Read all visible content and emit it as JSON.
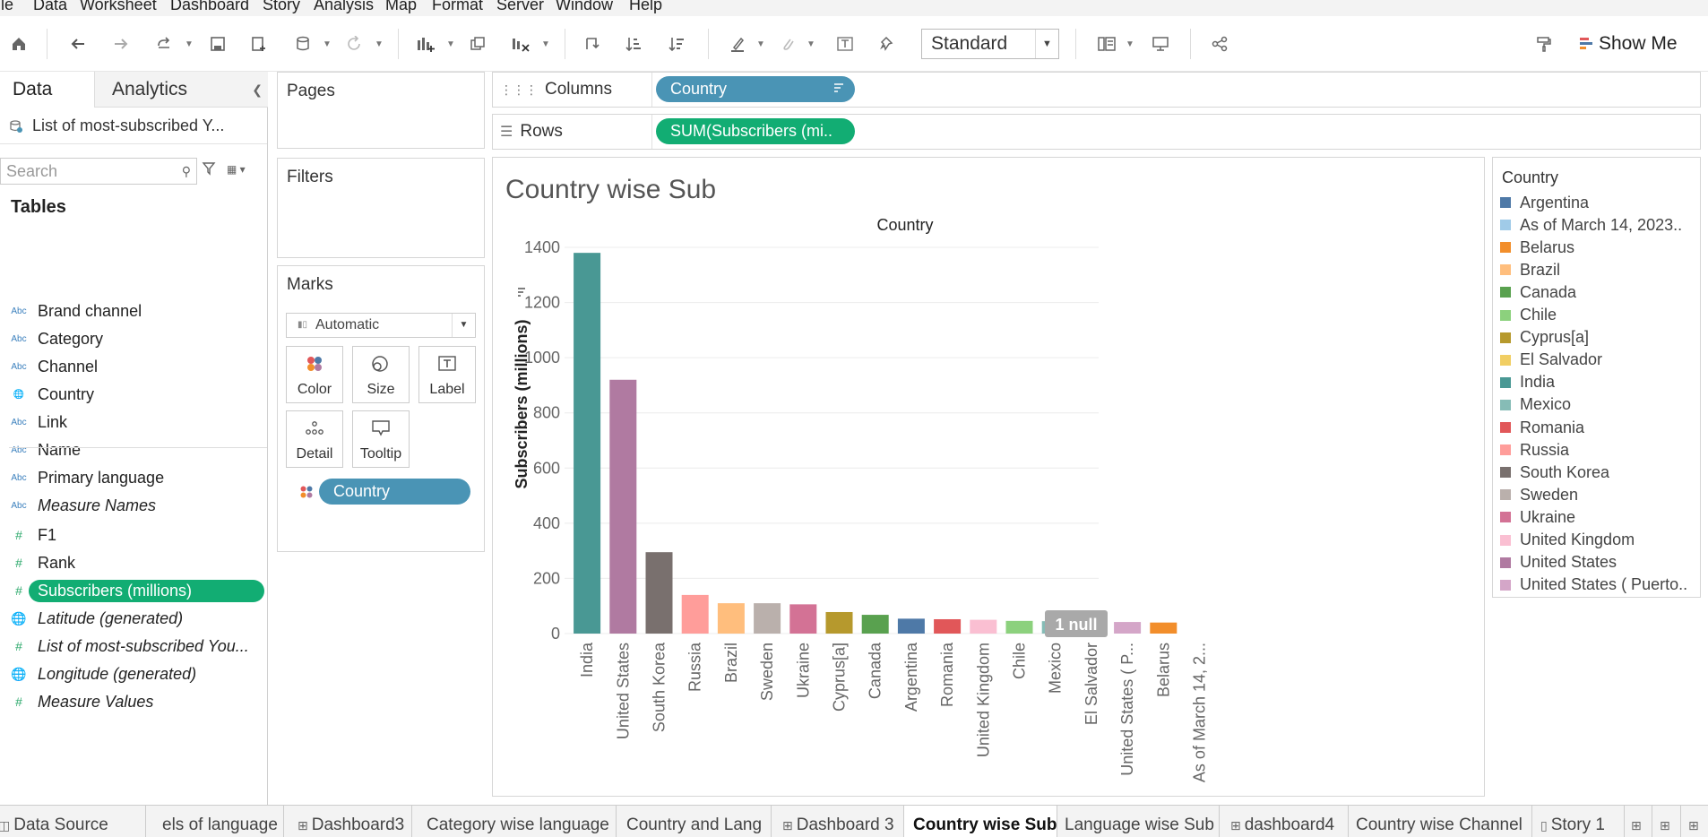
{
  "menu": [
    "File",
    "Data",
    "Worksheet",
    "Dashboard",
    "Story",
    "Analysis",
    "Map",
    "Format",
    "Server",
    "Window",
    "Help"
  ],
  "toolbar": {
    "view_size": "Standard",
    "show_me": "Show Me"
  },
  "data_pane": {
    "tabs": [
      "Data",
      "Analytics"
    ],
    "datasource": "List of most-subscribed Y...",
    "search_placeholder": "Search",
    "tables_header": "Tables",
    "dimensions": [
      {
        "type": "Abc",
        "name": "Brand channel"
      },
      {
        "type": "Abc",
        "name": "Category"
      },
      {
        "type": "Abc",
        "name": "Channel"
      },
      {
        "type": "geo",
        "name": "Country"
      },
      {
        "type": "Abc",
        "name": "Link"
      },
      {
        "type": "Abc",
        "name": "Name"
      },
      {
        "type": "Abc",
        "name": "Primary language"
      },
      {
        "type": "Abc",
        "name": "Measure Names"
      }
    ],
    "measures": [
      {
        "type": "#",
        "name": "F1"
      },
      {
        "type": "#",
        "name": "Rank"
      },
      {
        "type": "#",
        "name": "Subscribers (millions)"
      },
      {
        "type": "geo",
        "name": "Latitude (generated)"
      },
      {
        "type": "#",
        "name": "List of most-subscribed You..."
      },
      {
        "type": "geo",
        "name": "Longitude (generated)"
      },
      {
        "type": "#",
        "name": "Measure Values"
      }
    ]
  },
  "cards": {
    "pages": "Pages",
    "filters": "Filters",
    "marks": "Marks",
    "mark_type": "Automatic",
    "mark_buttons": [
      "Color",
      "Size",
      "Label",
      "Detail",
      "Tooltip"
    ],
    "marks_pill": "Country"
  },
  "shelves": {
    "columns_label": "Columns",
    "columns_pill": "Country",
    "rows_label": "Rows",
    "rows_pill": "SUM(Subscribers (mi.."
  },
  "view": {
    "sheet_title": "Country wise Sub",
    "null_badge": "1 null"
  },
  "legend": {
    "title": "Country",
    "items": [
      {
        "label": "Argentina",
        "color": "#4e79a7"
      },
      {
        "label": "As of March 14, 2023..",
        "color": "#a0cbe8"
      },
      {
        "label": "Belarus",
        "color": "#f28e2b"
      },
      {
        "label": "Brazil",
        "color": "#ffbe7d"
      },
      {
        "label": "Canada",
        "color": "#59a14f"
      },
      {
        "label": "Chile",
        "color": "#8cd17d"
      },
      {
        "label": "Cyprus[a]",
        "color": "#b6992d"
      },
      {
        "label": "El Salvador",
        "color": "#f1ce63"
      },
      {
        "label": "India",
        "color": "#499894"
      },
      {
        "label": "Mexico",
        "color": "#86bcb6"
      },
      {
        "label": "Romania",
        "color": "#e15759"
      },
      {
        "label": "Russia",
        "color": "#ff9d9a"
      },
      {
        "label": "South Korea",
        "color": "#79706e"
      },
      {
        "label": "Sweden",
        "color": "#bab0ac"
      },
      {
        "label": "Ukraine",
        "color": "#d37295"
      },
      {
        "label": "United Kingdom",
        "color": "#fabfd2"
      },
      {
        "label": "United States",
        "color": "#b07aa1"
      },
      {
        "label": "United States ( Puerto..",
        "color": "#d4a6c8"
      }
    ]
  },
  "chart_data": {
    "type": "bar",
    "title": "Country",
    "xlabel": "Country",
    "ylabel": "Subscribers (millions)",
    "ylim": [
      0,
      1400
    ],
    "yticks": [
      0,
      200,
      400,
      600,
      800,
      1000,
      1200,
      1400
    ],
    "categories": [
      "India",
      "United States",
      "South Korea",
      "Russia",
      "Brazil",
      "Sweden",
      "Ukraine",
      "Cyprus[a]",
      "Canada",
      "Argentina",
      "Romania",
      "United Kingdom",
      "Chile",
      "Mexico",
      "El Salvador",
      "United States ( P...",
      "Belarus",
      "As of March 14, 2..."
    ],
    "values": [
      1380,
      920,
      295,
      140,
      110,
      110,
      106,
      78,
      68,
      54,
      52,
      50,
      46,
      45,
      43,
      42,
      40,
      0
    ],
    "colors": [
      "#499894",
      "#b07aa1",
      "#79706e",
      "#ff9d9a",
      "#ffbe7d",
      "#bab0ac",
      "#d37295",
      "#b6992d",
      "#59a14f",
      "#4e79a7",
      "#e15759",
      "#fabfd2",
      "#8cd17d",
      "#86bcb6",
      "#f1ce63",
      "#d4a6c8",
      "#f28e2b",
      "#a0cbe8"
    ],
    "grid": true,
    "legend": "right"
  },
  "tabs": [
    {
      "label": "Data Source",
      "icon": "data-source-icon",
      "active": false
    },
    {
      "label": "els of language",
      "icon": "",
      "active": false
    },
    {
      "label": "Dashboard3",
      "icon": "dashboard-icon",
      "active": false
    },
    {
      "label": "Category wise language",
      "icon": "",
      "active": false
    },
    {
      "label": "Country and Lang",
      "icon": "",
      "active": false
    },
    {
      "label": "Dashboard 3",
      "icon": "dashboard-icon",
      "active": false
    },
    {
      "label": "Country wise Sub",
      "icon": "",
      "active": true
    },
    {
      "label": "Language wise Sub",
      "icon": "",
      "active": false
    },
    {
      "label": "dashboard4",
      "icon": "dashboard-icon",
      "active": false
    },
    {
      "label": "Country wise Channel",
      "icon": "",
      "active": false
    },
    {
      "label": "Story 1",
      "icon": "story-icon",
      "active": false
    }
  ]
}
